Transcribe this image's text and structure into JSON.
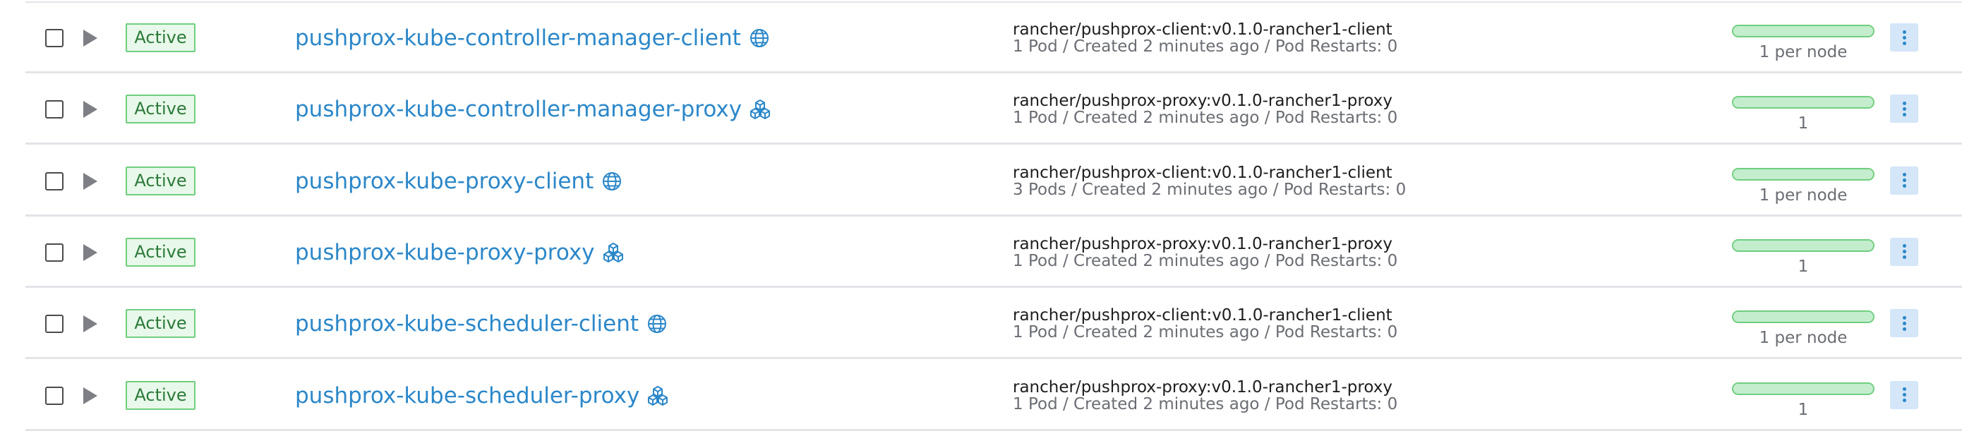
{
  "colors": {
    "link": "#2b87c9",
    "status_active_border": "#6fcf7f",
    "status_active_bg": "#e8f8ea",
    "status_active_text": "#2c7a39",
    "row_divider": "#e3e4e8",
    "menu_button_bg": "#d4e6f8"
  },
  "workloads": [
    {
      "status": "Active",
      "name": "pushprox-kube-controller-manager-client",
      "type_icon": "globe-icon",
      "image": "rancher/pushprox-client:v0.1.0-rancher1-client",
      "meta": "1 Pod / Created 2 minutes ago / Pod Restarts: 0",
      "scale_label": "1 per node",
      "scale_fraction": 1.0
    },
    {
      "status": "Active",
      "name": "pushprox-kube-controller-manager-proxy",
      "type_icon": "cubes-icon",
      "image": "rancher/pushprox-proxy:v0.1.0-rancher1-proxy",
      "meta": "1 Pod / Created 2 minutes ago / Pod Restarts: 0",
      "scale_label": "1",
      "scale_fraction": 1.0
    },
    {
      "status": "Active",
      "name": "pushprox-kube-proxy-client",
      "type_icon": "globe-icon",
      "image": "rancher/pushprox-client:v0.1.0-rancher1-client",
      "meta": "3 Pods / Created 2 minutes ago / Pod Restarts: 0",
      "scale_label": "1 per node",
      "scale_fraction": 1.0
    },
    {
      "status": "Active",
      "name": "pushprox-kube-proxy-proxy",
      "type_icon": "cubes-icon",
      "image": "rancher/pushprox-proxy:v0.1.0-rancher1-proxy",
      "meta": "1 Pod / Created 2 minutes ago / Pod Restarts: 0",
      "scale_label": "1",
      "scale_fraction": 1.0
    },
    {
      "status": "Active",
      "name": "pushprox-kube-scheduler-client",
      "type_icon": "globe-icon",
      "image": "rancher/pushprox-client:v0.1.0-rancher1-client",
      "meta": "1 Pod / Created 2 minutes ago / Pod Restarts: 0",
      "scale_label": "1 per node",
      "scale_fraction": 1.0
    },
    {
      "status": "Active",
      "name": "pushprox-kube-scheduler-proxy",
      "type_icon": "cubes-icon",
      "image": "rancher/pushprox-proxy:v0.1.0-rancher1-proxy",
      "meta": "1 Pod / Created 2 minutes ago / Pod Restarts: 0",
      "scale_label": "1",
      "scale_fraction": 1.0
    }
  ]
}
